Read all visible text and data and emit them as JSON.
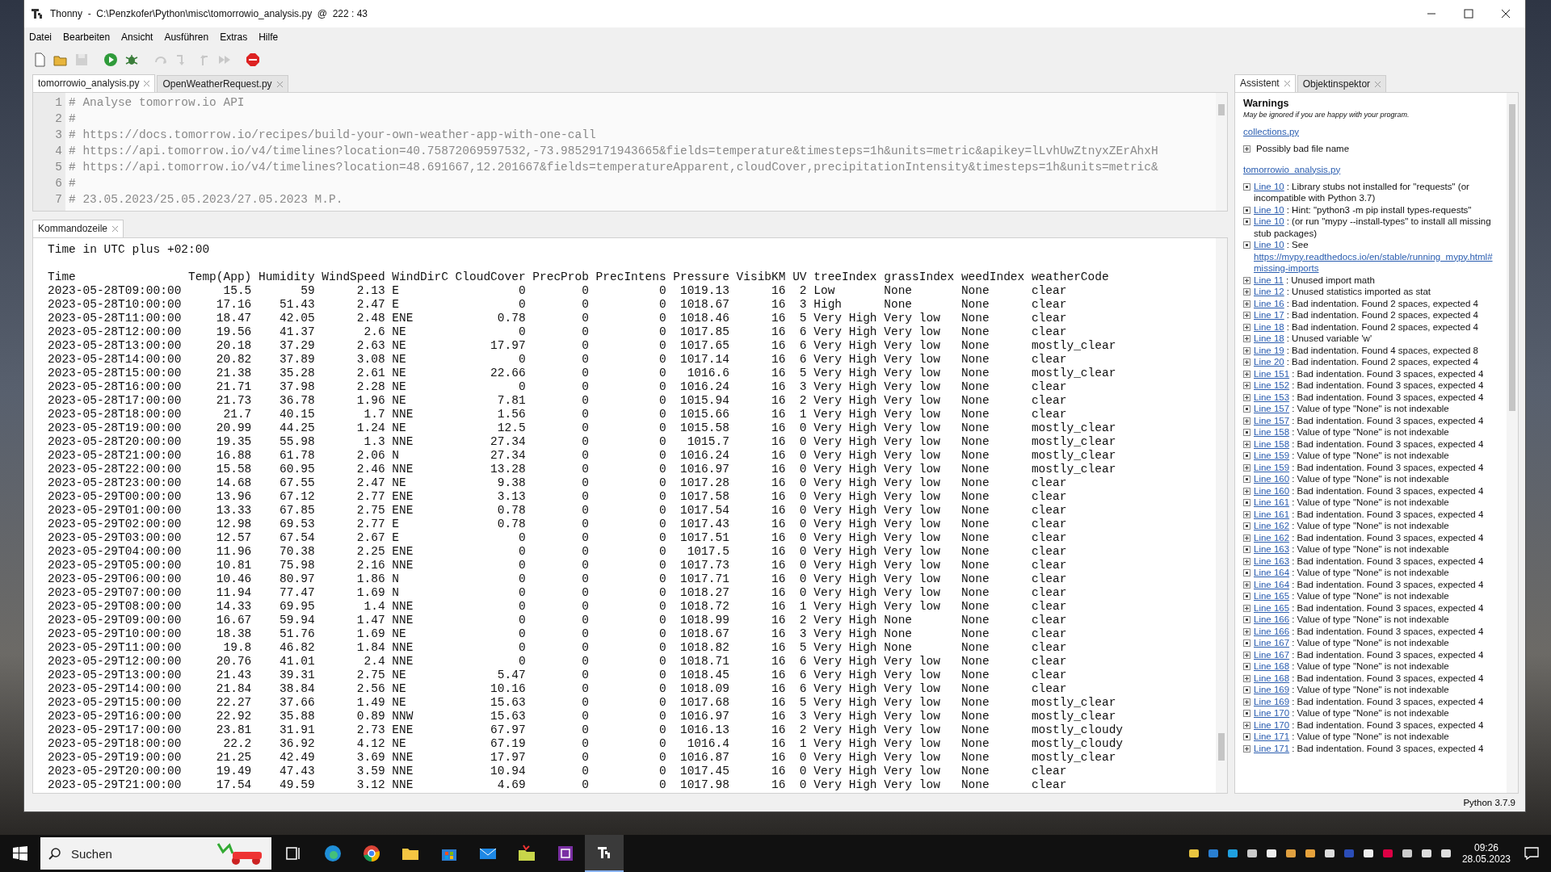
{
  "window": {
    "title": "Thonny  -  C:\\Penzkofer\\Python\\misc\\tomorrowio_analysis.py  @  222 : 43"
  },
  "menu": [
    "Datei",
    "Bearbeiten",
    "Ansicht",
    "Ausführen",
    "Extras",
    "Hilfe"
  ],
  "toolbar": [
    {
      "kind": "new",
      "disabled": false
    },
    {
      "kind": "open",
      "disabled": false
    },
    {
      "kind": "save",
      "disabled": true
    },
    {
      "kind": "run",
      "disabled": false
    },
    {
      "kind": "debug",
      "disabled": false
    },
    {
      "kind": "step_over",
      "disabled": true
    },
    {
      "kind": "step_into",
      "disabled": true
    },
    {
      "kind": "step_out",
      "disabled": true
    },
    {
      "kind": "resume",
      "disabled": true
    },
    {
      "kind": "stop",
      "disabled": false
    }
  ],
  "editor_tabs": [
    {
      "label": "tomorrowio_analysis.py",
      "selected": true
    },
    {
      "label": "OpenWeatherRequest.py",
      "selected": false
    }
  ],
  "editor_lines": [
    {
      "number": "1",
      "text": "# Analyse tomorrow.io API"
    },
    {
      "number": "2",
      "text": "#"
    },
    {
      "number": "3",
      "text": "# https://docs.tomorrow.io/recipes/build-your-own-weather-app-with-one-call"
    },
    {
      "number": "4",
      "text": "# https://api.tomorrow.io/v4/timelines?location=40.75872069597532,-73.98529171943665&fields=temperature&timesteps=1h&units=metric&apikey=lLvhUwZtnyxZErAhxH"
    },
    {
      "number": "5",
      "text": "# https://api.tomorrow.io/v4/timelines?location=48.691667,12.201667&fields=temperatureApparent,cloudCover,precipitationIntensity&timesteps=1h&units=metric&"
    },
    {
      "number": "6",
      "text": "#"
    },
    {
      "number": "7",
      "text": "# 23.05.2023/25.05.2023/27.05.2023 M.P."
    }
  ],
  "console_tabs": [
    {
      "label": "Kommandozeile",
      "selected": true
    }
  ],
  "console": {
    "intro": "Time in UTC plus +02:00",
    "columns": [
      "Time",
      "Temp(App)",
      "Humidity",
      "WindSpeed",
      "WindDirC",
      "CloudCover",
      "PrecProb",
      "PrecIntens",
      "Pressure",
      "VisibKM",
      "UV",
      "treeIndex",
      "grassIndex",
      "weedIndex",
      "weatherCode"
    ],
    "rows": [
      [
        "2023-05-28T09:00:00",
        "15.5",
        "59",
        "2.13",
        "E",
        "0",
        "0",
        "0",
        "1019.13",
        "16",
        "2",
        "Low",
        "None",
        "None",
        "clear"
      ],
      [
        "2023-05-28T10:00:00",
        "17.16",
        "51.43",
        "2.47",
        "E",
        "0",
        "0",
        "0",
        "1018.67",
        "16",
        "3",
        "High",
        "None",
        "None",
        "clear"
      ],
      [
        "2023-05-28T11:00:00",
        "18.47",
        "42.05",
        "2.48",
        "ENE",
        "0.78",
        "0",
        "0",
        "1018.46",
        "16",
        "5",
        "Very High",
        "Very low",
        "None",
        "clear"
      ],
      [
        "2023-05-28T12:00:00",
        "19.56",
        "41.37",
        "2.6",
        "NE",
        "0",
        "0",
        "0",
        "1017.85",
        "16",
        "6",
        "Very High",
        "Very low",
        "None",
        "clear"
      ],
      [
        "2023-05-28T13:00:00",
        "20.18",
        "37.29",
        "2.63",
        "NE",
        "17.97",
        "0",
        "0",
        "1017.65",
        "16",
        "6",
        "Very High",
        "Very low",
        "None",
        "mostly_clear"
      ],
      [
        "2023-05-28T14:00:00",
        "20.82",
        "37.89",
        "3.08",
        "NE",
        "0",
        "0",
        "0",
        "1017.14",
        "16",
        "6",
        "Very High",
        "Very low",
        "None",
        "clear"
      ],
      [
        "2023-05-28T15:00:00",
        "21.38",
        "35.28",
        "2.61",
        "NE",
        "22.66",
        "0",
        "0",
        "1016.6",
        "16",
        "5",
        "Very High",
        "Very low",
        "None",
        "mostly_clear"
      ],
      [
        "2023-05-28T16:00:00",
        "21.71",
        "37.98",
        "2.28",
        "NE",
        "0",
        "0",
        "0",
        "1016.24",
        "16",
        "3",
        "Very High",
        "Very low",
        "None",
        "clear"
      ],
      [
        "2023-05-28T17:00:00",
        "21.73",
        "36.78",
        "1.96",
        "NE",
        "7.81",
        "0",
        "0",
        "1015.94",
        "16",
        "2",
        "Very High",
        "Very low",
        "None",
        "clear"
      ],
      [
        "2023-05-28T18:00:00",
        "21.7",
        "40.15",
        "1.7",
        "NNE",
        "1.56",
        "0",
        "0",
        "1015.66",
        "16",
        "1",
        "Very High",
        "Very low",
        "None",
        "clear"
      ],
      [
        "2023-05-28T19:00:00",
        "20.99",
        "44.25",
        "1.24",
        "NE",
        "12.5",
        "0",
        "0",
        "1015.58",
        "16",
        "0",
        "Very High",
        "Very low",
        "None",
        "mostly_clear"
      ],
      [
        "2023-05-28T20:00:00",
        "19.35",
        "55.98",
        "1.3",
        "NNE",
        "27.34",
        "0",
        "0",
        "1015.7",
        "16",
        "0",
        "Very High",
        "Very low",
        "None",
        "mostly_clear"
      ],
      [
        "2023-05-28T21:00:00",
        "16.88",
        "61.78",
        "2.06",
        "N",
        "27.34",
        "0",
        "0",
        "1016.24",
        "16",
        "0",
        "Very High",
        "Very low",
        "None",
        "mostly_clear"
      ],
      [
        "2023-05-28T22:00:00",
        "15.58",
        "60.95",
        "2.46",
        "NNE",
        "13.28",
        "0",
        "0",
        "1016.97",
        "16",
        "0",
        "Very High",
        "Very low",
        "None",
        "mostly_clear"
      ],
      [
        "2023-05-28T23:00:00",
        "14.68",
        "67.55",
        "2.47",
        "NE",
        "9.38",
        "0",
        "0",
        "1017.28",
        "16",
        "0",
        "Very High",
        "Very low",
        "None",
        "clear"
      ],
      [
        "2023-05-29T00:00:00",
        "13.96",
        "67.12",
        "2.77",
        "ENE",
        "3.13",
        "0",
        "0",
        "1017.58",
        "16",
        "0",
        "Very High",
        "Very low",
        "None",
        "clear"
      ],
      [
        "2023-05-29T01:00:00",
        "13.33",
        "67.85",
        "2.75",
        "ENE",
        "0.78",
        "0",
        "0",
        "1017.54",
        "16",
        "0",
        "Very High",
        "Very low",
        "None",
        "clear"
      ],
      [
        "2023-05-29T02:00:00",
        "12.98",
        "69.53",
        "2.77",
        "E",
        "0.78",
        "0",
        "0",
        "1017.43",
        "16",
        "0",
        "Very High",
        "Very low",
        "None",
        "clear"
      ],
      [
        "2023-05-29T03:00:00",
        "12.57",
        "67.54",
        "2.67",
        "E",
        "0",
        "0",
        "0",
        "1017.51",
        "16",
        "0",
        "Very High",
        "Very low",
        "None",
        "clear"
      ],
      [
        "2023-05-29T04:00:00",
        "11.96",
        "70.38",
        "2.25",
        "ENE",
        "0",
        "0",
        "0",
        "1017.5",
        "16",
        "0",
        "Very High",
        "Very low",
        "None",
        "clear"
      ],
      [
        "2023-05-29T05:00:00",
        "10.81",
        "75.98",
        "2.16",
        "NNE",
        "0",
        "0",
        "0",
        "1017.73",
        "16",
        "0",
        "Very High",
        "Very low",
        "None",
        "clear"
      ],
      [
        "2023-05-29T06:00:00",
        "10.46",
        "80.97",
        "1.86",
        "N",
        "0",
        "0",
        "0",
        "1017.71",
        "16",
        "0",
        "Very High",
        "Very low",
        "None",
        "clear"
      ],
      [
        "2023-05-29T07:00:00",
        "11.94",
        "77.47",
        "1.69",
        "N",
        "0",
        "0",
        "0",
        "1018.27",
        "16",
        "0",
        "Very High",
        "Very low",
        "None",
        "clear"
      ],
      [
        "2023-05-29T08:00:00",
        "14.33",
        "69.95",
        "1.4",
        "NNE",
        "0",
        "0",
        "0",
        "1018.72",
        "16",
        "1",
        "Very High",
        "Very low",
        "None",
        "clear"
      ],
      [
        "2023-05-29T09:00:00",
        "16.67",
        "59.94",
        "1.47",
        "NNE",
        "0",
        "0",
        "0",
        "1018.99",
        "16",
        "2",
        "Very High",
        "None",
        "None",
        "clear"
      ],
      [
        "2023-05-29T10:00:00",
        "18.38",
        "51.76",
        "1.69",
        "NE",
        "0",
        "0",
        "0",
        "1018.67",
        "16",
        "3",
        "Very High",
        "None",
        "None",
        "clear"
      ],
      [
        "2023-05-29T11:00:00",
        "19.8",
        "46.82",
        "1.84",
        "NNE",
        "0",
        "0",
        "0",
        "1018.82",
        "16",
        "5",
        "Very High",
        "None",
        "None",
        "clear"
      ],
      [
        "2023-05-29T12:00:00",
        "20.76",
        "41.01",
        "2.4",
        "NNE",
        "0",
        "0",
        "0",
        "1018.71",
        "16",
        "6",
        "Very High",
        "Very low",
        "None",
        "clear"
      ],
      [
        "2023-05-29T13:00:00",
        "21.43",
        "39.31",
        "2.75",
        "NE",
        "5.47",
        "0",
        "0",
        "1018.45",
        "16",
        "6",
        "Very High",
        "Very low",
        "None",
        "clear"
      ],
      [
        "2023-05-29T14:00:00",
        "21.84",
        "38.84",
        "2.56",
        "NE",
        "10.16",
        "0",
        "0",
        "1018.09",
        "16",
        "6",
        "Very High",
        "Very low",
        "None",
        "clear"
      ],
      [
        "2023-05-29T15:00:00",
        "22.27",
        "37.66",
        "1.49",
        "NE",
        "15.63",
        "0",
        "0",
        "1017.68",
        "16",
        "5",
        "Very High",
        "Very low",
        "None",
        "mostly_clear"
      ],
      [
        "2023-05-29T16:00:00",
        "22.92",
        "35.88",
        "0.89",
        "NNW",
        "15.63",
        "0",
        "0",
        "1016.97",
        "16",
        "3",
        "Very High",
        "Very low",
        "None",
        "mostly_clear"
      ],
      [
        "2023-05-29T17:00:00",
        "23.81",
        "31.91",
        "2.73",
        "ENE",
        "67.97",
        "0",
        "0",
        "1016.13",
        "16",
        "2",
        "Very High",
        "Very low",
        "None",
        "mostly_cloudy"
      ],
      [
        "2023-05-29T18:00:00",
        "22.2",
        "36.92",
        "4.12",
        "NE",
        "67.19",
        "0",
        "0",
        "1016.4",
        "16",
        "1",
        "Very High",
        "Very low",
        "None",
        "mostly_cloudy"
      ],
      [
        "2023-05-29T19:00:00",
        "21.25",
        "42.49",
        "3.69",
        "NNE",
        "17.97",
        "0",
        "0",
        "1016.87",
        "16",
        "0",
        "Very High",
        "Very low",
        "None",
        "mostly_clear"
      ],
      [
        "2023-05-29T20:00:00",
        "19.49",
        "47.43",
        "3.59",
        "NNE",
        "10.94",
        "0",
        "0",
        "1017.45",
        "16",
        "0",
        "Very High",
        "Very low",
        "None",
        "clear"
      ],
      [
        "2023-05-29T21:00:00",
        "17.54",
        "49.59",
        "3.12",
        "NNE",
        "4.69",
        "0",
        "0",
        "1017.98",
        "16",
        "0",
        "Very High",
        "Very low",
        "None",
        "clear"
      ]
    ]
  },
  "side_tabs": [
    {
      "label": "Assistent",
      "selected": true
    },
    {
      "label": "Objektinspektor",
      "selected": false
    }
  ],
  "assistant": {
    "title": "Warnings",
    "subtitle": "May be ignored if you are happy with your program.",
    "files": [
      {
        "name": "collections.py",
        "items": [
          {
            "kind": "plus",
            "text": "Possibly bad file name"
          }
        ]
      },
      {
        "name": "tomorrowio_analysis.py",
        "items": [
          {
            "kind": "dot",
            "line": "Line 10",
            "text": ": Library stubs not installed for \"requests\" (or incompatible with Python 3.7)"
          },
          {
            "kind": "dot",
            "line": "Line 10",
            "text": ": Hint: \"python3 -m pip install types-requests\""
          },
          {
            "kind": "dot",
            "line": "Line 10",
            "text": ": (or run \"mypy --install-types\" to install all missing stub packages)"
          },
          {
            "kind": "dot",
            "line": "Line 10",
            "text": ": See",
            "url": "https://mypy.readthedocs.io/en/stable/running_mypy.html#missing-imports"
          },
          {
            "kind": "plus",
            "line": "Line 11",
            "text": ": Unused import math"
          },
          {
            "kind": "plus",
            "line": "Line 12",
            "text": ": Unused statistics imported as stat"
          },
          {
            "kind": "plus",
            "line": "Line 16",
            "text": ": Bad indentation. Found 2 spaces, expected 4"
          },
          {
            "kind": "plus",
            "line": "Line 17",
            "text": ": Bad indentation. Found 2 spaces, expected 4"
          },
          {
            "kind": "plus",
            "line": "Line 18",
            "text": ": Bad indentation. Found 2 spaces, expected 4"
          },
          {
            "kind": "plus",
            "line": "Line 18",
            "text": ": Unused variable 'w'"
          },
          {
            "kind": "plus",
            "line": "Line 19",
            "text": ": Bad indentation. Found 4 spaces, expected 8"
          },
          {
            "kind": "plus",
            "line": "Line 20",
            "text": ": Bad indentation. Found 2 spaces, expected 4"
          },
          {
            "kind": "plus",
            "line": "Line 151",
            "text": ": Bad indentation. Found 3 spaces, expected 4"
          },
          {
            "kind": "plus",
            "line": "Line 152",
            "text": ": Bad indentation. Found 3 spaces, expected 4"
          },
          {
            "kind": "plus",
            "line": "Line 153",
            "text": ": Bad indentation. Found 3 spaces, expected 4"
          },
          {
            "kind": "dot",
            "line": "Line 157",
            "text": ": Value of type \"None\" is not indexable"
          },
          {
            "kind": "plus",
            "line": "Line 157",
            "text": ": Bad indentation. Found 3 spaces, expected 4"
          },
          {
            "kind": "dot",
            "line": "Line 158",
            "text": ": Value of type \"None\" is not indexable"
          },
          {
            "kind": "plus",
            "line": "Line 158",
            "text": ": Bad indentation. Found 3 spaces, expected 4"
          },
          {
            "kind": "dot",
            "line": "Line 159",
            "text": ": Value of type \"None\" is not indexable"
          },
          {
            "kind": "plus",
            "line": "Line 159",
            "text": ": Bad indentation. Found 3 spaces, expected 4"
          },
          {
            "kind": "dot",
            "line": "Line 160",
            "text": ": Value of type \"None\" is not indexable"
          },
          {
            "kind": "plus",
            "line": "Line 160",
            "text": ": Bad indentation. Found 3 spaces, expected 4"
          },
          {
            "kind": "dot",
            "line": "Line 161",
            "text": ": Value of type \"None\" is not indexable"
          },
          {
            "kind": "plus",
            "line": "Line 161",
            "text": ": Bad indentation. Found 3 spaces, expected 4"
          },
          {
            "kind": "dot",
            "line": "Line 162",
            "text": ": Value of type \"None\" is not indexable"
          },
          {
            "kind": "plus",
            "line": "Line 162",
            "text": ": Bad indentation. Found 3 spaces, expected 4"
          },
          {
            "kind": "dot",
            "line": "Line 163",
            "text": ": Value of type \"None\" is not indexable"
          },
          {
            "kind": "plus",
            "line": "Line 163",
            "text": ": Bad indentation. Found 3 spaces, expected 4"
          },
          {
            "kind": "dot",
            "line": "Line 164",
            "text": ": Value of type \"None\" is not indexable"
          },
          {
            "kind": "plus",
            "line": "Line 164",
            "text": ": Bad indentation. Found 3 spaces, expected 4"
          },
          {
            "kind": "dot",
            "line": "Line 165",
            "text": ": Value of type \"None\" is not indexable"
          },
          {
            "kind": "plus",
            "line": "Line 165",
            "text": ": Bad indentation. Found 3 spaces, expected 4"
          },
          {
            "kind": "dot",
            "line": "Line 166",
            "text": ": Value of type \"None\" is not indexable"
          },
          {
            "kind": "plus",
            "line": "Line 166",
            "text": ": Bad indentation. Found 3 spaces, expected 4"
          },
          {
            "kind": "dot",
            "line": "Line 167",
            "text": ": Value of type \"None\" is not indexable"
          },
          {
            "kind": "plus",
            "line": "Line 167",
            "text": ": Bad indentation. Found 3 spaces, expected 4"
          },
          {
            "kind": "dot",
            "line": "Line 168",
            "text": ": Value of type \"None\" is not indexable"
          },
          {
            "kind": "plus",
            "line": "Line 168",
            "text": ": Bad indentation. Found 3 spaces, expected 4"
          },
          {
            "kind": "dot",
            "line": "Line 169",
            "text": ": Value of type \"None\" is not indexable"
          },
          {
            "kind": "plus",
            "line": "Line 169",
            "text": ": Bad indentation. Found 3 spaces, expected 4"
          },
          {
            "kind": "dot",
            "line": "Line 170",
            "text": ": Value of type \"None\" is not indexable"
          },
          {
            "kind": "plus",
            "line": "Line 170",
            "text": ": Bad indentation. Found 3 spaces, expected 4"
          },
          {
            "kind": "dot",
            "line": "Line 171",
            "text": ": Value of type \"None\" is not indexable"
          },
          {
            "kind": "plus",
            "line": "Line 171",
            "text": ": Bad indentation. Found 3 spaces, expected 4"
          }
        ]
      }
    ]
  },
  "status_bar": "Python 3.7.9",
  "taskbar": {
    "search_placeholder": "Suchen",
    "apps": [
      {
        "kind": "taskview",
        "selected": false
      },
      {
        "kind": "edge",
        "selected": false
      },
      {
        "kind": "chrome",
        "selected": false
      },
      {
        "kind": "explorer",
        "selected": false
      },
      {
        "kind": "store",
        "selected": false
      },
      {
        "kind": "mail",
        "selected": false
      },
      {
        "kind": "files",
        "selected": false
      },
      {
        "kind": "square_app",
        "selected": false
      },
      {
        "kind": "thonny",
        "selected": true
      }
    ],
    "time": "09:26",
    "date": "28.05.2023"
  }
}
